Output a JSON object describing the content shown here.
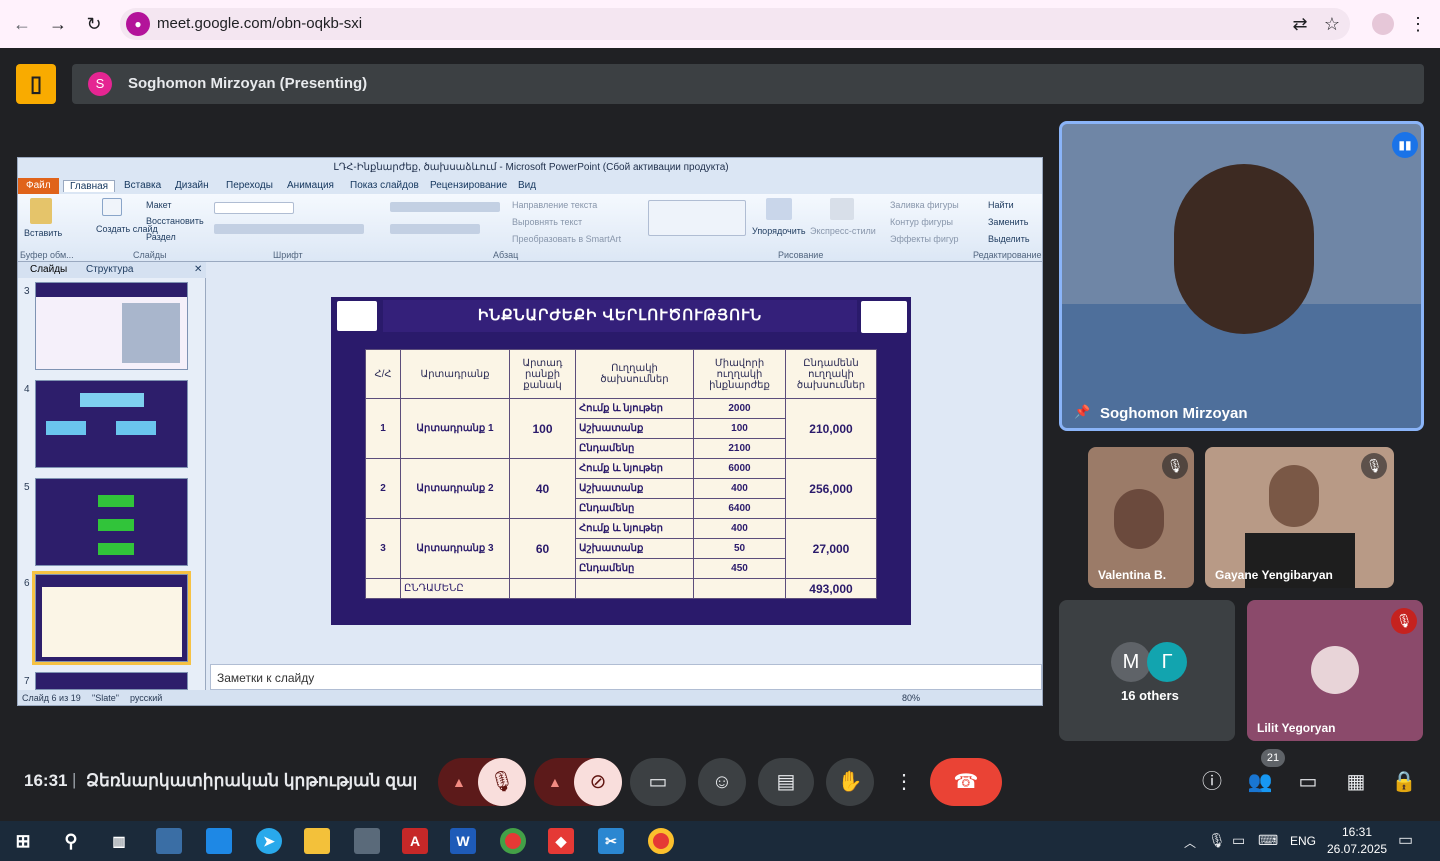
{
  "browser": {
    "url": "meet.google.com/obn-oqkb-sxi"
  },
  "meet": {
    "presenter_initial": "S",
    "presenter_banner": "Soghomon Mirzoyan (Presenting)",
    "main_speaker": "Soghomon Mirzoyan",
    "tiles": [
      {
        "name": "Valentina B."
      },
      {
        "name": "Gayane Yengibaryan"
      },
      {
        "name": "Lilit Yegoryan"
      }
    ],
    "others": {
      "initials": [
        "M",
        "Г"
      ],
      "label": "16 others"
    },
    "time": "16:31",
    "meeting_title": "Ձեռնարկատիրական կրթության զարգ...",
    "participant_count": "21"
  },
  "ppt": {
    "title": "ԼԴՀ-Ինքնարժեք, ծախսաձևում - Microsoft PowerPoint (Сбой активации продукта)",
    "menu": [
      "Файл",
      "Главная",
      "Вставка",
      "Дизайн",
      "Переходы",
      "Анимация",
      "Показ слайдов",
      "Рецензирование",
      "Вид"
    ],
    "ribbon": {
      "paste": "Вставить",
      "create_slide": "Создать слайд",
      "layout": "Макет",
      "reset": "Восстановить",
      "section": "Раздел",
      "text_dir": "Направление текста",
      "align_text": "Выровнять текст",
      "smartart": "Преобразовать в SmartArt",
      "arrange": "Упорядочить",
      "quick_styles": "Экспресс-стили",
      "fill": "Заливка фигуры",
      "outline": "Контур фигуры",
      "effects": "Эффекты фигур",
      "find": "Найти",
      "replace": "Заменить",
      "select": "Выделить",
      "groups": [
        "Буфер обм...",
        "Слайды",
        "Шрифт",
        "Абзац",
        "Рисование",
        "Редактирование"
      ]
    },
    "panel_tabs": [
      "Слайды",
      "Структура"
    ],
    "thumb_numbers": [
      "3",
      "4",
      "5",
      "6",
      "7"
    ],
    "slide": {
      "title": "ԻՆՔՆԱՐԺԵՔԻ ՎԵՐԼՈՒԾՈՒԹՅՈՒՆ",
      "headers": [
        "Հ/Հ",
        "Արտադրանք",
        "Արտադ րանքի քանակ",
        "Ուղղակի ծախսումներ",
        "Միավորի ուղղակի ինքնարժեք",
        "Ընդամենն ուղղակի ծախսումներ"
      ],
      "rows": [
        {
          "n": "1",
          "name": "Արտադրանք 1",
          "qty": "100",
          "total": "210,000",
          "items": [
            [
              "Հումք և նյութեր",
              "2000"
            ],
            [
              "Աշխատանք",
              "100"
            ],
            [
              "Ընդամենը",
              "2100"
            ]
          ]
        },
        {
          "n": "2",
          "name": "Արտադրանք 2",
          "qty": "40",
          "total": "256,000",
          "items": [
            [
              "Հումք և նյութեր",
              "6000"
            ],
            [
              "Աշխատանք",
              "400"
            ],
            [
              "Ընդամենը",
              "6400"
            ]
          ]
        },
        {
          "n": "3",
          "name": "Արտադրանք 3",
          "qty": "60",
          "total": "27,000",
          "items": [
            [
              "Հումք և նյութեր",
              "400"
            ],
            [
              "Աշխատանք",
              "50"
            ],
            [
              "Ընդամենը",
              "450"
            ]
          ]
        }
      ],
      "total_label": "ԸՆԴԱՄԵՆԸ",
      "total_value": "493,000"
    },
    "notes": "Заметки к слайду",
    "status": {
      "slide": "Слайд 6 из 19",
      "theme": "\"Slate\"",
      "lang": "русский",
      "zoom": "80%"
    }
  },
  "taskbar": {
    "lang": "ENG",
    "time": "16:31",
    "date": "26.07.2025"
  }
}
